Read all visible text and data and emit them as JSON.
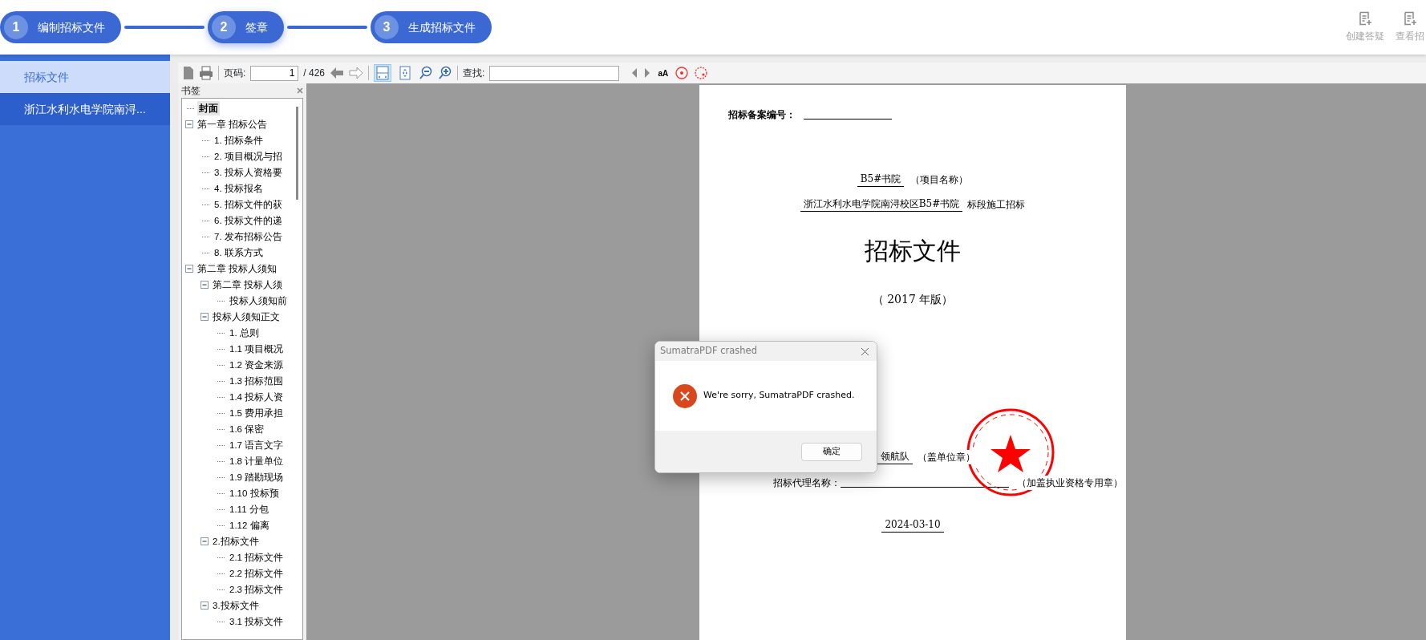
{
  "steps": [
    {
      "number": "1",
      "label": "编制招标文件",
      "selected": false
    },
    {
      "number": "2",
      "label": "签章",
      "selected": true
    },
    {
      "number": "3",
      "label": "生成招标文件",
      "selected": false
    }
  ],
  "header_actions": [
    {
      "label": "创建答疑"
    },
    {
      "label": "查看招"
    }
  ],
  "sidebar": {
    "items": [
      {
        "label": "招标文件",
        "selected": true
      },
      {
        "label": "浙江水利水电学院南浔...",
        "selected": false
      }
    ]
  },
  "toolbar": {
    "page_label": "页码:",
    "page_value": "1",
    "page_total": "/ 426",
    "find_label": "查找:",
    "case_label": "aA",
    "view_buttons": [
      {
        "kind": "fit-page",
        "selected": true
      },
      {
        "kind": "fit-width",
        "selected": false
      }
    ]
  },
  "bookmarks": {
    "title": "书签",
    "items": [
      {
        "label": "封面",
        "selected": true
      },
      {
        "label": "第一章 招标公告",
        "selected": false,
        "expanded": true,
        "children": [
          {
            "label": "1. 招标条件",
            "selected": false
          },
          {
            "label": "2. 项目概况与招",
            "selected": false
          },
          {
            "label": "3. 投标人资格要",
            "selected": false
          },
          {
            "label": "4. 投标报名",
            "selected": false
          },
          {
            "label": "5. 招标文件的获",
            "selected": false
          },
          {
            "label": "6. 投标文件的递",
            "selected": false
          },
          {
            "label": "7. 发布招标公告",
            "selected": false
          },
          {
            "label": "8. 联系方式",
            "selected": false
          }
        ]
      },
      {
        "label": "第二章 投标人须知",
        "selected": false,
        "expanded": true,
        "children": [
          {
            "label": "第二章 投标人须",
            "selected": false,
            "expanded": true,
            "children": [
              {
                "label": "投标人须知前",
                "selected": false
              }
            ]
          },
          {
            "label": "投标人须知正文",
            "selected": false,
            "expanded": true,
            "children": [
              {
                "label": "1. 总则",
                "selected": false
              },
              {
                "label": "1.1 项目概况",
                "selected": false
              },
              {
                "label": "1.2 资金来源",
                "selected": false
              },
              {
                "label": "1.3 招标范围",
                "selected": false
              },
              {
                "label": "1.4 投标人资",
                "selected": false
              },
              {
                "label": "1.5 费用承担",
                "selected": false
              },
              {
                "label": "1.6 保密",
                "selected": false
              },
              {
                "label": "1.7 语言文字",
                "selected": false
              },
              {
                "label": "1.8 计量单位",
                "selected": false
              },
              {
                "label": "1.9 踏勘现场",
                "selected": false
              },
              {
                "label": "1.10 投标预",
                "selected": false
              },
              {
                "label": "1.11 分包",
                "selected": false
              },
              {
                "label": "1.12 偏离",
                "selected": false
              }
            ]
          },
          {
            "label": "2.招标文件",
            "selected": false,
            "expanded": true,
            "children": [
              {
                "label": "2.1 招标文件",
                "selected": false
              },
              {
                "label": "2.2 招标文件",
                "selected": false
              },
              {
                "label": "2.3 招标文件",
                "selected": false
              }
            ]
          },
          {
            "label": "3.投标文件",
            "selected": false,
            "expanded": true,
            "children": [
              {
                "label": "3.1 投标文件",
                "selected": false
              }
            ]
          }
        ]
      }
    ]
  },
  "document": {
    "record_label": "招标备案编号：",
    "project_name": "B5#书院",
    "project_suffix": "（项目名称）",
    "section_name": "浙江水利水电学院南浔校区B5#书院",
    "section_suffix": "标段施工招标",
    "title": "招标文件",
    "edition": "（ 2017 年版）",
    "tenderer_name": "领航队",
    "tenderer_suffix": "（盖单位章）",
    "agent_label": "招标代理名称：",
    "agent_suffix": "（加盖执业资格专用章）",
    "date": "2024-03-10"
  },
  "dialog": {
    "title": "SumatraPDF crashed",
    "message": "We're sorry, SumatraPDF crashed.",
    "button": "确定"
  }
}
